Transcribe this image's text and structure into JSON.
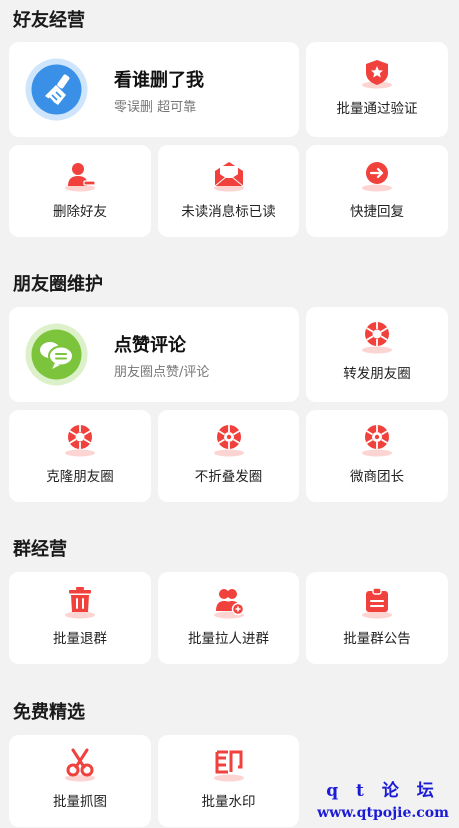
{
  "sections": [
    {
      "title": "好友经营"
    },
    {
      "title": "朋友圈维护"
    },
    {
      "title": "群经营"
    },
    {
      "title": "免费精选"
    }
  ],
  "friend": {
    "featured": {
      "title": "看谁删了我",
      "subtitle": "零误删 超可靠",
      "icon": "broom-icon"
    },
    "items": [
      {
        "label": "批量通过验证",
        "icon": "shield-icon"
      },
      {
        "label": "删除好友",
        "icon": "remove-user-icon"
      },
      {
        "label": "未读消息标已读",
        "icon": "mail-icon"
      },
      {
        "label": "快捷回复",
        "icon": "reply-icon"
      }
    ]
  },
  "moments": {
    "featured": {
      "title": "点赞评论",
      "subtitle": "朋友圈点赞/评论",
      "icon": "chat-icon"
    },
    "items": [
      {
        "label": "转发朋友圈",
        "icon": "aperture-icon"
      },
      {
        "label": "克隆朋友圈",
        "icon": "aperture-icon"
      },
      {
        "label": "不折叠发圈",
        "icon": "aperture-icon"
      },
      {
        "label": "微商团长",
        "icon": "aperture-icon"
      }
    ]
  },
  "group": {
    "items": [
      {
        "label": "批量退群",
        "icon": "trash-icon"
      },
      {
        "label": "批量拉人进群",
        "icon": "add-users-icon"
      },
      {
        "label": "批量群公告",
        "icon": "clipboard-icon"
      }
    ]
  },
  "free": {
    "items": [
      {
        "label": "批量抓图",
        "icon": "scissors-icon"
      },
      {
        "label": "批量水印",
        "icon": "seal-icon"
      }
    ]
  },
  "watermark": {
    "line1": "q t 论 坛",
    "line2": "www.qtpojie.com"
  },
  "colors": {
    "accent": "#f0413c",
    "featured_blue": "#3a90e6",
    "featured_green": "#7cc43c"
  }
}
